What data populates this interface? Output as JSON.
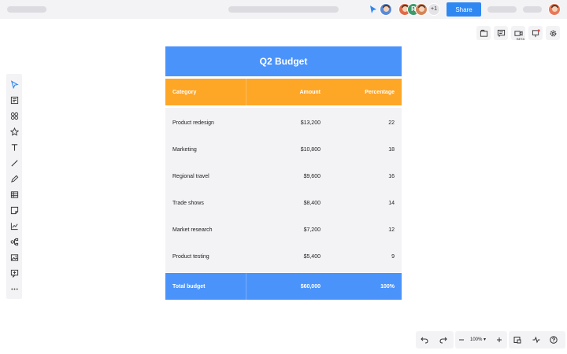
{
  "topbar": {
    "collaborator_more": "+1",
    "collaborator_initial": "R",
    "share_label": "Share"
  },
  "right_tools": {
    "beta_label": "BETA"
  },
  "table": {
    "title": "Q2 Budget",
    "headers": [
      "Category",
      "Amount",
      "Percentage"
    ],
    "rows": [
      [
        "Product redesign",
        "$13,200",
        "22"
      ],
      [
        "Marketing",
        "$10,800",
        "18"
      ],
      [
        "Regional travel",
        "$9,600",
        "16"
      ],
      [
        "Trade shows",
        "$8,400",
        "14"
      ],
      [
        "Market research",
        "$7,200",
        "12"
      ],
      [
        "Product testing",
        "$5,400",
        "9"
      ]
    ],
    "total": [
      "Total budget",
      "$60,000",
      "100%"
    ]
  },
  "bottom": {
    "zoom_level": "100%"
  },
  "colors": {
    "title_bg": "#4a93fb",
    "header_bg": "#fea626",
    "body_bg": "#f3f3f5",
    "share_button": "#2f88f2"
  },
  "icons": {
    "left_toolbar": [
      "select-icon",
      "template-icon",
      "shapes-icon",
      "sticker-icon",
      "text-icon",
      "line-icon",
      "pen-icon",
      "table-icon",
      "sticky-note-icon",
      "chart-icon",
      "mindmap-icon",
      "image-icon",
      "comment-icon",
      "more-icon"
    ],
    "right_toolbar": [
      "frames-icon",
      "comment-board-icon",
      "video-icon",
      "present-icon",
      "settings-icon"
    ],
    "bottom_toolbar": [
      "undo-icon",
      "redo-icon",
      "zoom-out-icon",
      "zoom-in-icon",
      "minimap-icon",
      "activity-icon",
      "help-icon"
    ]
  }
}
